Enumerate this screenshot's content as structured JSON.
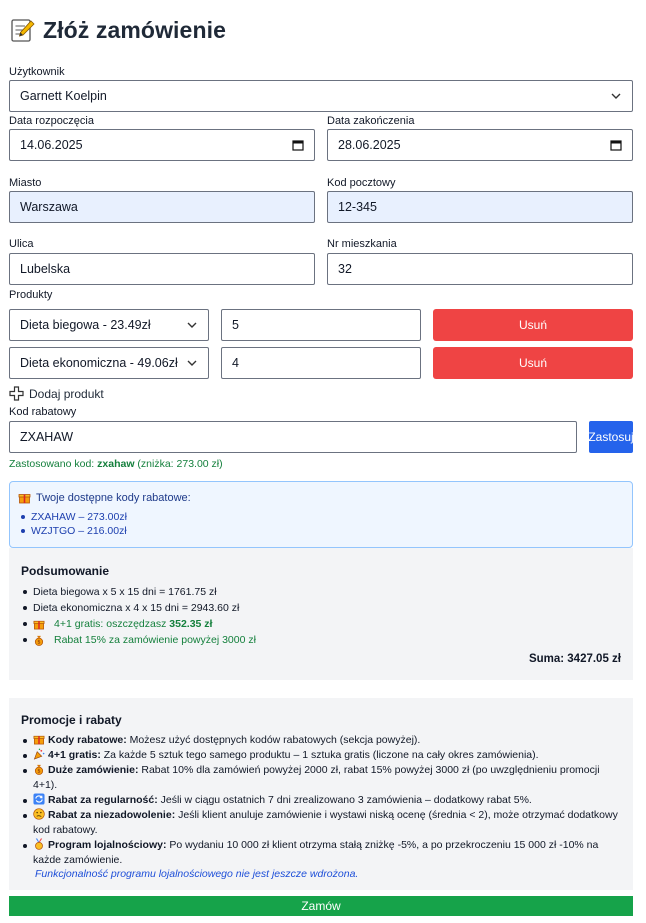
{
  "header": {
    "title": "Złóż zamówienie",
    "icon": "memo-icon"
  },
  "form": {
    "user": {
      "label": "Użytkownik",
      "value": "Garnett Koelpin"
    },
    "start_date": {
      "label": "Data rozpoczęcia",
      "value": "14.06.2025"
    },
    "end_date": {
      "label": "Data zakończenia",
      "value": "28.06.2025"
    },
    "city": {
      "label": "Miasto",
      "value": "Warszawa"
    },
    "postal_code": {
      "label": "Kod pocztowy",
      "value": "12-345"
    },
    "street": {
      "label": "Ulica",
      "value": "Lubelska"
    },
    "apartment": {
      "label": "Nr mieszkania",
      "value": "32"
    },
    "products_label": "Produkty",
    "products": [
      {
        "name": "Dieta biegowa - 23.49zł",
        "quantity": "5",
        "remove_label": "Usuń"
      },
      {
        "name": "Dieta ekonomiczna - 49.06zł",
        "quantity": "4",
        "remove_label": "Usuń"
      }
    ],
    "add_product_label": "Dodaj produkt",
    "discount": {
      "label": "Kod rabatowy",
      "value": "ZXAHAW",
      "apply_label": "Zastosuj",
      "applied_prefix": "Zastosowano kod:",
      "applied_code": "zxahaw",
      "applied_suffix": "(zniżka: 273.00 zł)"
    }
  },
  "available_codes": {
    "title": "Twoje dostępne kody rabatowe:",
    "items": [
      "ZXAHAW – 273.00zł",
      "WZJTGO – 216.00zł"
    ]
  },
  "summary": {
    "title": "Podsumowanie",
    "lines": [
      {
        "text": "Dieta biegowa x 5 x 15 dni = 1761.75 zł"
      },
      {
        "text": "Dieta ekonomiczna x 4 x 15 dni = 2943.60 zł"
      },
      {
        "text": "4+1 gratis: oszczędzasz ",
        "bold": "352.35 zł",
        "icon": "gift-icon"
      },
      {
        "text": "Rabat 15% za zamówienie powyżej 3000 zł",
        "icon": "money-bag-icon"
      }
    ],
    "total": "Suma: 3427.05 zł"
  },
  "promotions": {
    "title": "Promocje i rabaty",
    "items": [
      {
        "icon": "gift-icon",
        "name": "Kody rabatowe:",
        "text": " Możesz użyć dostępnych kodów rabatowych (sekcja powyżej)."
      },
      {
        "icon": "party-popper-icon",
        "name": "4+1 gratis:",
        "text": " Za każde 5 sztuk tego samego produktu – 1 sztuka gratis (liczone na cały okres zamówienia)."
      },
      {
        "icon": "money-bag-icon",
        "name": "Duże zamówienie:",
        "text": " Rabat 10% dla zamówień powyżej 2000 zł, rabat 15% powyżej 3000 zł (po uwzględnieniu promocji 4+1)."
      },
      {
        "icon": "repeat-icon",
        "name": "Rabat za regularność:",
        "text": " Jeśli w ciągu ostatnich 7 dni zrealizowano 3 zamówienia – dodatkowy rabat 5%."
      },
      {
        "icon": "confused-face-icon",
        "name": "Rabat za niezadowolenie:",
        "text": " Jeśli klient anuluje zamówienie i wystawi niską ocenę (średnia < 2), może otrzymać dodatkowy kod rabatowy."
      },
      {
        "icon": "medal-icon",
        "name": "Program lojalnościowy:",
        "text": " Po wydaniu 10 000 zł klient otrzyma stałą zniżkę -5%, a po przekroczeniu 15 000 zł -10% na każde zamówienie."
      }
    ],
    "note": "Funkcjonalność programu lojalnościowego nie jest jeszcze wdrożona."
  },
  "submit_label": "Zamów",
  "colors": {
    "danger": "#ef4444",
    "primary": "#2563eb",
    "success": "#16a34a",
    "info_bg": "#eff6ff",
    "panel_bg": "#f3f4f6"
  }
}
